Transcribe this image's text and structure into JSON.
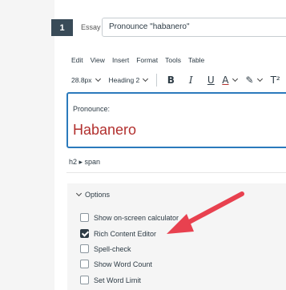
{
  "question": {
    "number": "1",
    "type": "Essay",
    "title_value": "Pronounce \"habanero\""
  },
  "menubar": [
    "Edit",
    "View",
    "Insert",
    "Format",
    "Tools",
    "Table"
  ],
  "toolbar": {
    "font_size": "28.8px",
    "block_style": "Heading 2",
    "bold": "B",
    "italic": "I",
    "underline": "U",
    "text_color": "A",
    "highlight": "✎",
    "superscript": "T²"
  },
  "editor": {
    "label": "Pronounce:",
    "heading": "Habanero",
    "heading_color": "#b2302e",
    "focus_border_color": "#2b7abc"
  },
  "statusbar": {
    "path": "h2 ▸ span"
  },
  "options": {
    "title": "Options",
    "items": [
      {
        "label": "Show on-screen calculator",
        "checked": false
      },
      {
        "label": "Rich Content Editor",
        "checked": true
      },
      {
        "label": "Spell-check",
        "checked": false
      },
      {
        "label": "Show Word Count",
        "checked": false
      },
      {
        "label": "Set Word Limit",
        "checked": false
      }
    ]
  },
  "annotation": {
    "arrow_color": "#e8414f",
    "points_to": "Rich Content Editor"
  }
}
